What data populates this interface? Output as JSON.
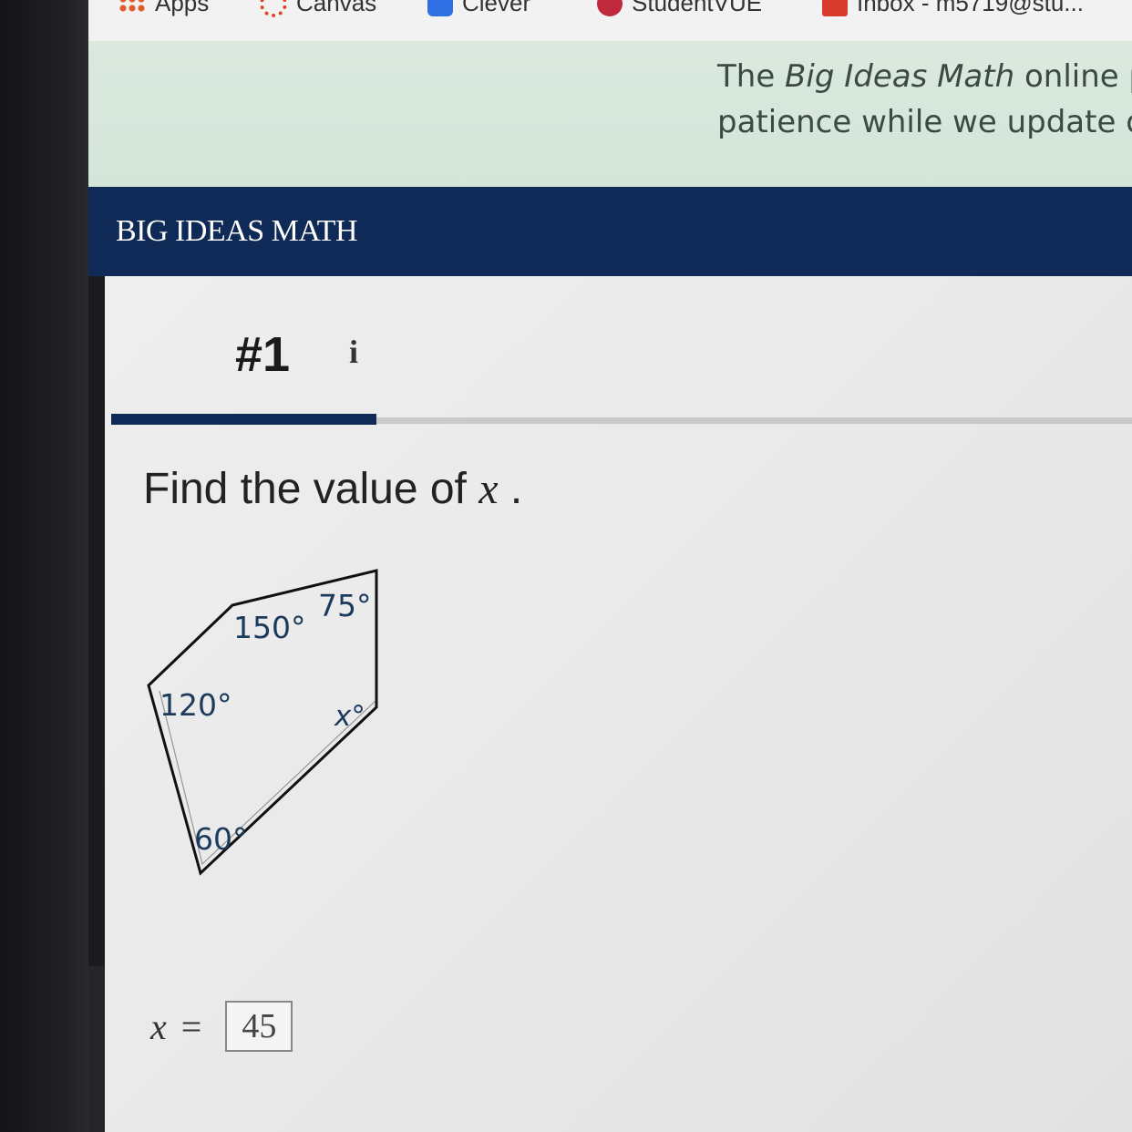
{
  "bookmarks": [
    {
      "label": "Apps",
      "icon": "apps-grid-icon"
    },
    {
      "label": "Canvas",
      "icon": "canvas-icon"
    },
    {
      "label": "Clever",
      "icon": "clever-icon"
    },
    {
      "label": "StudentVUE",
      "icon": "studentvue-icon"
    },
    {
      "label": "Inbox - m5719@stu...",
      "icon": "gmail-icon"
    }
  ],
  "banner": {
    "line1_prefix": "The ",
    "line1_emph": "Big Ideas Math",
    "line1_suffix": " online p",
    "line2": "patience while we update o"
  },
  "header": {
    "logo": "BIG IDEAS MATH"
  },
  "question": {
    "number": "#1",
    "info": "i",
    "prompt_text": "Find the value of ",
    "prompt_var": "x",
    "prompt_end": " .",
    "progress": 0.26
  },
  "figure": {
    "angles": {
      "a150": "150°",
      "a75": "75°",
      "a120": "120°",
      "ax": "x°",
      "a60": "60°"
    }
  },
  "answer": {
    "var": "x",
    "eq": "=",
    "value": "45"
  },
  "colors": {
    "navy": "#0f2a56",
    "banner": "#d3e5d9",
    "background": "#e8e8e8"
  }
}
